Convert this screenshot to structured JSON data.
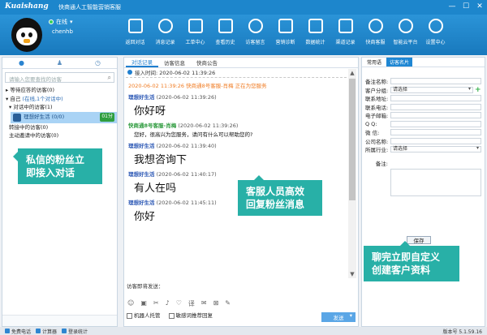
{
  "app": {
    "logo": "Kuaishang",
    "title": "快商通人工智能营销客服",
    "window": {
      "min": "—",
      "max": "☐",
      "close": "✕"
    }
  },
  "user": {
    "status": "在线",
    "name": "chenhb"
  },
  "toolbar": [
    {
      "label": "返回对话",
      "icon": "return-icon"
    },
    {
      "label": "消息记录",
      "icon": "message-log-icon"
    },
    {
      "label": "工单中心",
      "icon": "workorder-icon"
    },
    {
      "label": "查看历史",
      "icon": "history-icon"
    },
    {
      "label": "访客留言",
      "icon": "leave-message-icon"
    },
    {
      "label": "营销诊断",
      "icon": "diagnosis-icon"
    },
    {
      "label": "数据统计",
      "icon": "stats-icon"
    },
    {
      "label": "渠道记录",
      "icon": "channel-icon"
    },
    {
      "label": "快商客服",
      "icon": "support-icon"
    },
    {
      "label": "智能云平台",
      "icon": "cloud-icon"
    },
    {
      "label": "设置中心",
      "icon": "settings-icon"
    }
  ],
  "left": {
    "search_placeholder": "请输入您要查找的访客",
    "tree": {
      "waiting": "等待应答的访客(0)",
      "self": "自己",
      "self_status": "(在线,1个对话中)",
      "group": "对话中的访客(1)",
      "visitor_name": "理想好生活 (0/0)",
      "visitor_tag": "01分",
      "transferring": "转接中的访客(0)",
      "active": "主动邀请中的访客(0)"
    }
  },
  "callouts": {
    "left": "私信的粉丝立\n即接入对话",
    "mid": "客服人员高效\n回复粉丝消息",
    "right": "聊完立即自定义\n创建客户资料"
  },
  "mid": {
    "tabs": [
      "对话记录",
      "访客信息",
      "快商公告"
    ],
    "access_time": "接入时间: 2020-06-02 11:39:26",
    "messages": [
      {
        "type": "sys",
        "text": "2020-06-02 11:39:26 快商通8号客服-肖梅 正在为您服务"
      },
      {
        "type": "visitor",
        "who": "理想好生活",
        "time": "(2020-06-02 11:39:26)",
        "body": "你好呀"
      },
      {
        "type": "agent",
        "who": "快商通8号客服-肖梅",
        "time": "(2020-06-02 11:39:26)",
        "body": "您好，很高兴为您服务，请问有什么可以帮助您的?"
      },
      {
        "type": "visitor",
        "who": "理想好生活",
        "time": "(2020-06-02 11:39:40)",
        "body": "我想咨询下"
      },
      {
        "type": "visitor",
        "who": "理想好生活",
        "time": "(2020-06-02 11:40:17)",
        "body": "有人在吗"
      },
      {
        "type": "visitor",
        "who": "理想好生活",
        "time": "(2020-06-02 11:45:11)",
        "body": "你好"
      }
    ],
    "input_label": "访客即将发送：",
    "robot_label": "机器人托管",
    "sensitive_label": "敏感词推荐回复",
    "send_label": "发送"
  },
  "right": {
    "tabs": [
      "常用语",
      "访客名片"
    ],
    "fields": [
      {
        "label": "备注名称:",
        "value": ""
      },
      {
        "label": "客户分组:",
        "value": "请选择",
        "dropdown": true
      },
      {
        "label": "联系地址:",
        "value": ""
      },
      {
        "label": "联系电话:",
        "value": ""
      },
      {
        "label": "电子邮箱:",
        "value": ""
      },
      {
        "label": "Q      Q:",
        "value": ""
      },
      {
        "label": "微      信:",
        "value": ""
      },
      {
        "label": "公司名称:",
        "value": ""
      },
      {
        "label": "所属行业:",
        "value": "请选择",
        "dropdown": true
      }
    ],
    "note_label": "备注:",
    "save_label": "保存"
  },
  "statusbar": {
    "items": [
      "免费电话",
      "计算器",
      "登录统计"
    ],
    "version": "版本号 5.1.59.16"
  }
}
